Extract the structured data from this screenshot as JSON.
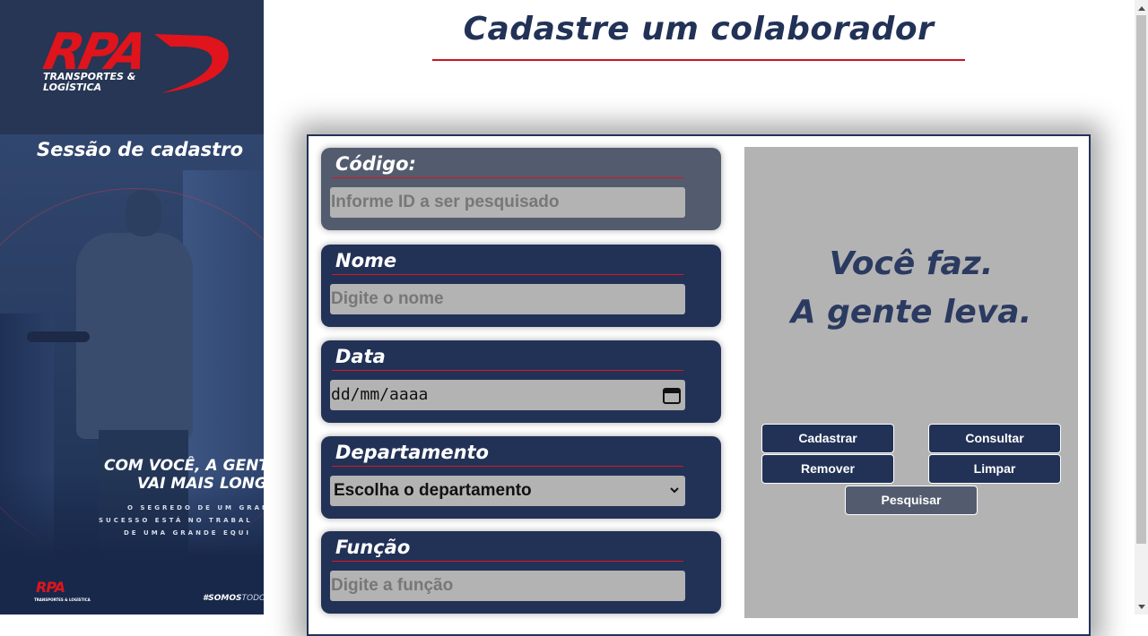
{
  "brand": {
    "logo_text": "RPA",
    "logo_sub_line1": "TRANSPORTES &",
    "logo_sub_line2": "LOGÍSTICA",
    "red": "#e0141c",
    "navy": "#223257"
  },
  "sidebar": {
    "section_title": "Sessão de cadastro",
    "slogan_line1": "COM VOCÊ, A GENT",
    "slogan_line2": "VAI MAIS LONG",
    "tag_line1": "O SEGREDO DE UM GRAN",
    "tag_line2": "SUCESSO ESTÁ NO TRABAL",
    "tag_line3": "DE UMA GRANDE EQUI",
    "mini_logo": "RPA",
    "mini_logo_sub": "TRANSPORTES & LOGÍSTICA",
    "hashtag_bold": "#SOMOS",
    "hashtag_rest": "TODOS"
  },
  "header": {
    "title": "Cadastre um colaborador"
  },
  "form": {
    "codigo": {
      "label": "Código:",
      "placeholder": "Informe ID a ser pesquisado"
    },
    "nome": {
      "label": "Nome",
      "placeholder": "Digite o nome"
    },
    "data": {
      "label": "Data",
      "value": "dd/mm/aaaa"
    },
    "departamento": {
      "label": "Departamento",
      "selected": "Escolha o departamento"
    },
    "funcao": {
      "label": "Função",
      "placeholder": "Digite a função"
    }
  },
  "panel": {
    "slogan_line1": "Você faz.",
    "slogan_line2": "A gente leva."
  },
  "buttons": {
    "cadastrar": "Cadastrar",
    "consultar": "Consultar",
    "remover": "Remover",
    "limpar": "Limpar",
    "pesquisar": "Pesquisar"
  }
}
